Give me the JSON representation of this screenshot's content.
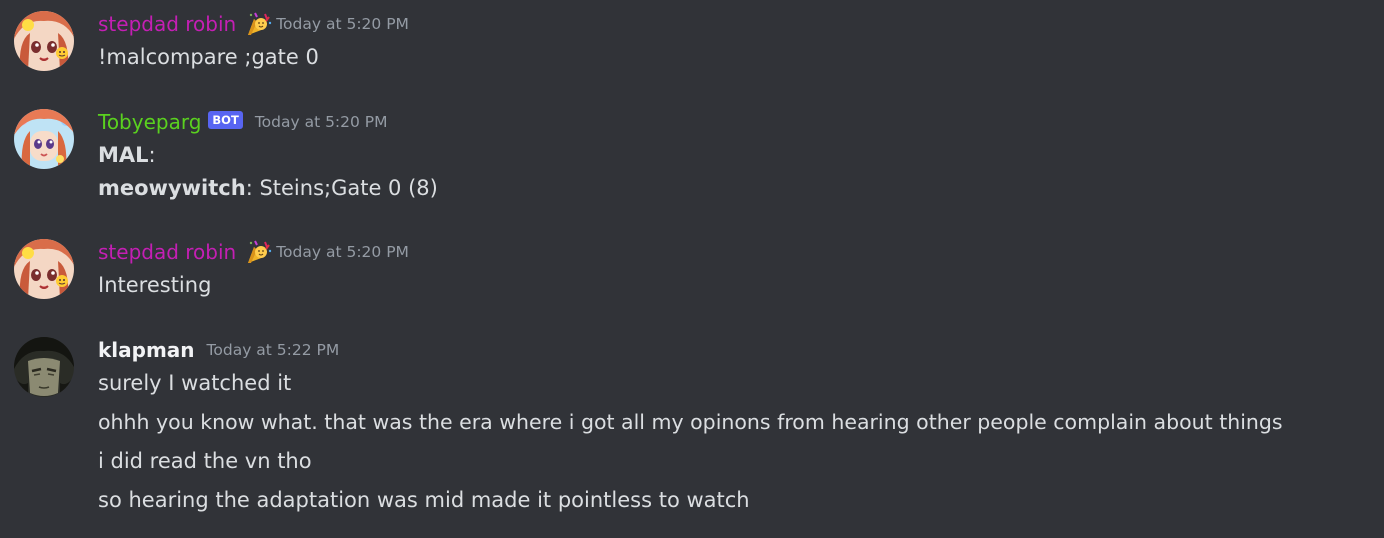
{
  "messages": [
    {
      "username": "stepdad robin",
      "username_color": "#c41fb4",
      "role_icon": "party-emoji-icon",
      "timestamp": "Today at 5:20 PM",
      "lines": [
        "!malcompare ;gate 0"
      ]
    },
    {
      "username": "Tobyeparg",
      "username_color": "#5ad11f",
      "badge": "BOT",
      "timestamp": "Today at 5:20 PM",
      "lines": [
        {
          "bold": "MAL",
          "rest": ":"
        },
        {
          "bold": "meowywitch",
          "rest": ": Steins;Gate 0 (8)"
        }
      ]
    },
    {
      "username": "stepdad robin",
      "username_color": "#c41fb4",
      "role_icon": "party-emoji-icon",
      "timestamp": "Today at 5:20 PM",
      "lines": [
        "Interesting"
      ]
    },
    {
      "username": "klapman",
      "username_color": "#f2f3f5",
      "timestamp": "Today at 5:22 PM",
      "lines": [
        "surely I watched it",
        "ohhh you know what. that was the era where i got all my opinons from hearing other people complain about things",
        "i did read the vn tho",
        "so hearing the adaptation was mid made it pointless to watch"
      ]
    }
  ]
}
